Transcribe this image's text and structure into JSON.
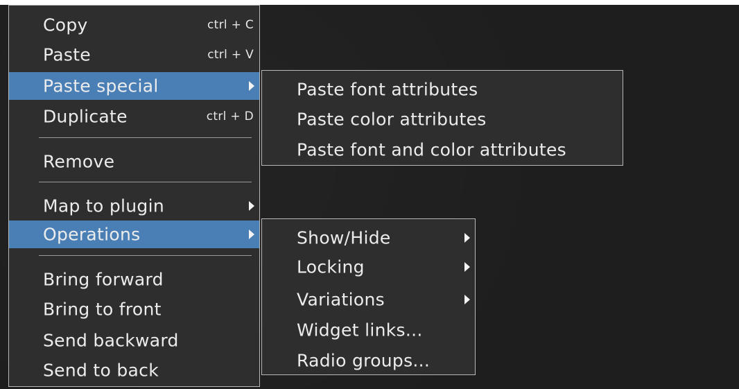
{
  "context_menu": {
    "items": [
      {
        "label": "Copy",
        "shortcut": "ctrl + C"
      },
      {
        "label": "Paste",
        "shortcut": "ctrl + V"
      },
      {
        "label": "Paste special",
        "has_submenu": true,
        "active": true
      },
      {
        "label": "Duplicate",
        "shortcut": "ctrl + D"
      },
      {
        "label": "Remove"
      },
      {
        "label": "Map to plugin",
        "has_submenu": true
      },
      {
        "label": "Operations",
        "has_submenu": true,
        "active": true
      },
      {
        "label": "Bring forward"
      },
      {
        "label": "Bring to front"
      },
      {
        "label": "Send backward"
      },
      {
        "label": "Send to back"
      }
    ]
  },
  "paste_special_submenu": {
    "items": [
      {
        "label": "Paste font attributes"
      },
      {
        "label": "Paste color attributes"
      },
      {
        "label": "Paste font and color attributes"
      }
    ]
  },
  "operations_submenu": {
    "items": [
      {
        "label": "Show/Hide",
        "has_submenu": true
      },
      {
        "label": "Locking",
        "has_submenu": true
      },
      {
        "label": "Variations",
        "has_submenu": true
      },
      {
        "label": "Widget links..."
      },
      {
        "label": "Radio groups..."
      }
    ]
  },
  "colors": {
    "background": "#1e1e1e",
    "menu_background": "#2e2e2e",
    "menu_border": "#b8b8b8",
    "highlight": "#4a7fb6",
    "text": "#ececec"
  },
  "icons": {
    "submenu_arrow": "triangle-right-icon"
  }
}
